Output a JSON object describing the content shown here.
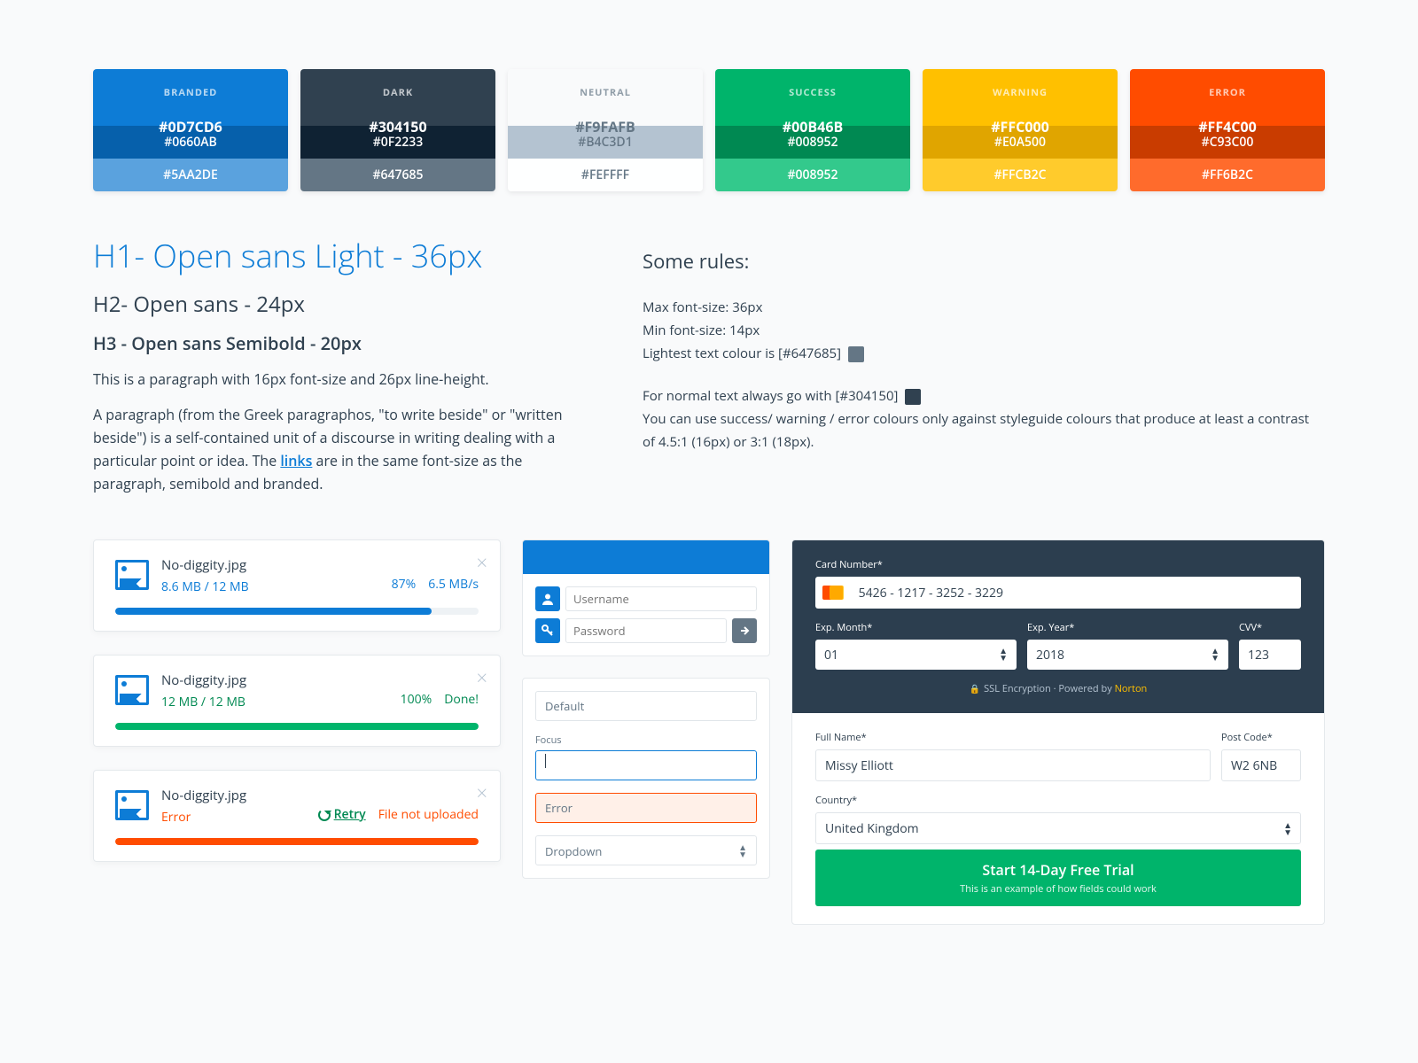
{
  "palettes": [
    {
      "name": "BRANDED",
      "main": "#0D7CD6",
      "v2": "#0660AB",
      "v3": "#5AA2DE",
      "text": "#fff",
      "v3text": "#fff"
    },
    {
      "name": "DARK",
      "main": "#304150",
      "v2": "#0F2233",
      "v3": "#647685",
      "text": "#fff",
      "v3text": "#fff"
    },
    {
      "name": "NEUTRAL",
      "main": "#F9FAFB",
      "v2": "#B4C3D1",
      "v3": "#FEFFFF",
      "text": "#647685",
      "v3text": "#647685",
      "maintext": "#647685"
    },
    {
      "name": "SUCCESS",
      "main": "#00B46B",
      "v2": "#008952",
      "v3": "#008952",
      "text": "#fff",
      "v3bg": "#33c98c",
      "v3text": "#fff"
    },
    {
      "name": "WARNING",
      "main": "#FFC000",
      "v2": "#E0A500",
      "v3": "#FFCB2C",
      "text": "#fff",
      "v3text": "#fff"
    },
    {
      "name": "ERROR",
      "main": "#FF4C00",
      "v2": "#C93C00",
      "v3": "#FF6B2C",
      "text": "#fff",
      "v3text": "#fff"
    }
  ],
  "typo": {
    "h1": "H1- Open sans Light - 36px",
    "h2": "H2- Open sans - 24px",
    "h3": "H3 - Open sans Semibold - 20px",
    "p1": "This is a paragraph with 16px font-size and 26px line-height.",
    "p2a": "A paragraph (from the Greek paragraphos, \"to write beside\" or \"written beside\") is a self-contained unit of a discourse in writing dealing with a particular point or idea. The ",
    "link": "links",
    "p2b": " are in the same font-size as the paragraph, semibold and branded."
  },
  "rules": {
    "heading": "Some rules:",
    "r1": "Max font-size: 36px",
    "r2": "Min font-size: 14px",
    "r3": "Lightest text colour is [#647685]",
    "r4": "For normal text always go with [#304150]",
    "r5": "You can use success/ warning / error colours only against styleguide colours that produce at least a contrast of 4.5:1 (16px) or 3:1 (18px).",
    "chip1": "#647685",
    "chip2": "#304150"
  },
  "uploads": [
    {
      "name": "No-diggity.jpg",
      "sub": "8.6 MB / 12 MB",
      "percent": "87%",
      "speed": "6.5 MB/s",
      "color": "#0d7cd6",
      "subcolor": "#0d7cd6",
      "metacolor": "#0d7cd6",
      "bar": 87,
      "status": "progress"
    },
    {
      "name": "No-diggity.jpg",
      "sub": "12 MB / 12 MB",
      "percent": "100%",
      "speed": "Done!",
      "color": "#00b46b",
      "subcolor": "#008952",
      "metacolor": "#008952",
      "bar": 100,
      "status": "done"
    },
    {
      "name": "No-diggity.jpg",
      "sub": "Error",
      "retry": "Retry",
      "speed": "File not uploaded",
      "color": "#ff4c00",
      "subcolor": "#ff4c00",
      "metacolor": "#ff4c00",
      "bar": 100,
      "status": "error"
    }
  ],
  "login": {
    "username_ph": "Username",
    "password_ph": "Password"
  },
  "inputs": {
    "default": "Default",
    "focus_label": "Focus",
    "error": "Error",
    "dropdown": "Dropdown"
  },
  "payment": {
    "card_label": "Card Number*",
    "card_value": "5426 - 1217 - 3252 - 3229",
    "month_label": "Exp. Month*",
    "month_value": "01",
    "year_label": "Exp. Year*",
    "year_value": "2018",
    "cvv_label": "CVV*",
    "cvv_value": "123",
    "ssl": "SSL Encryption · Powered by ",
    "ssl_link": "Norton",
    "name_label": "Full Name*",
    "name_value": "Missy Elliott",
    "post_label": "Post Code*",
    "post_value": "W2 6NB",
    "country_label": "Country*",
    "country_value": "United Kingdom",
    "cta": "Start 14-Day Free Trial",
    "cta_sub": "This is an example of how fields could work"
  }
}
